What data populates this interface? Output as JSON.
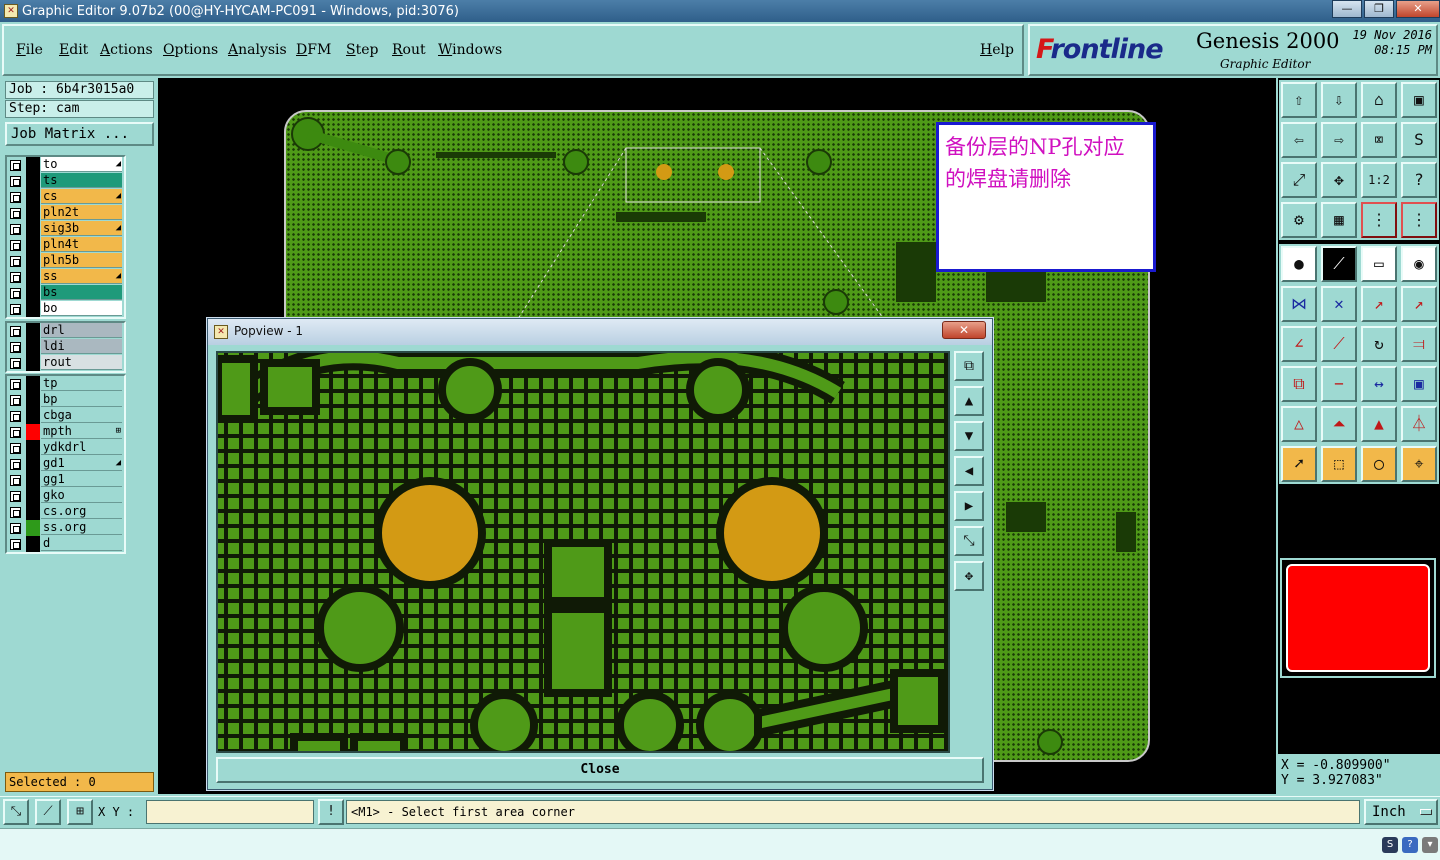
{
  "window": {
    "title": "Graphic Editor 9.07b2 (00@HY-HYCAM-PC091 - Windows, pid:3076)",
    "icon": "app-icon"
  },
  "menu": {
    "items": [
      "File",
      "Edit",
      "Actions",
      "Options",
      "Analysis",
      "DFM",
      "Step",
      "Rout",
      "Windows"
    ],
    "help": "Help"
  },
  "logo": {
    "brand_f": "F",
    "brand_rest": "rontline",
    "product": "Genesis 2000",
    "subtitle": "Graphic Editor",
    "date": "19 Nov 2016",
    "time": "08:15 PM"
  },
  "job": {
    "job_label": "Job : 6b4r3015a0",
    "step_label": "Step: cam",
    "matrix_button": "Job Matrix ..."
  },
  "layers": {
    "group1": [
      {
        "name": "to",
        "color": "#ffffff",
        "mark": "◢"
      },
      {
        "name": "ts",
        "color": "#1f9a7a",
        "mark": ""
      },
      {
        "name": "cs",
        "color": "#f2b84a",
        "mark": "◢"
      },
      {
        "name": "pln2t",
        "color": "#f2b84a",
        "mark": ""
      },
      {
        "name": "sig3b",
        "color": "#f2b84a",
        "mark": "◢"
      },
      {
        "name": "pln4t",
        "color": "#f2b84a",
        "mark": ""
      },
      {
        "name": "pln5b",
        "color": "#f2b84a",
        "mark": ""
      },
      {
        "name": "ss",
        "color": "#f2b84a",
        "mark": "◢"
      },
      {
        "name": "bs",
        "color": "#1f9a7a",
        "mark": ""
      },
      {
        "name": "bo",
        "color": "#ffffff",
        "mark": ""
      }
    ],
    "group2": [
      {
        "name": "drl",
        "color": "#aab8c0",
        "mark": ""
      },
      {
        "name": "ldi",
        "color": "#aab8c0",
        "mark": ""
      },
      {
        "name": "rout",
        "color": "#d8e0e2",
        "mark": ""
      }
    ],
    "group3": [
      {
        "name": "tp",
        "color": "#9ed9d2",
        "mark": ""
      },
      {
        "name": "bp",
        "color": "#9ed9d2",
        "mark": ""
      },
      {
        "name": "cbga",
        "color": "#9ed9d2",
        "mark": ""
      },
      {
        "name": "mpth",
        "color": "#9ed9d2",
        "mark": "⊞"
      },
      {
        "name": "ydkdrl",
        "color": "#9ed9d2",
        "mark": ""
      },
      {
        "name": "gd1",
        "color": "#9ed9d2",
        "mark": "◢"
      },
      {
        "name": "gg1",
        "color": "#9ed9d2",
        "mark": ""
      },
      {
        "name": "gko",
        "color": "#9ed9d2",
        "mark": ""
      },
      {
        "name": "cs.org",
        "color": "#9ed9d2",
        "mark": ""
      },
      {
        "name": "ss.org",
        "color": "#9ed9d2",
        "mark": ""
      },
      {
        "name": "d",
        "color": "#9ed9d2",
        "mark": ""
      }
    ],
    "swatch_colors": {
      "mpth": "#ff0000",
      "ss.org": "#2e9a1a",
      "default": "#000000"
    },
    "selected": "Selected : 0"
  },
  "annotation": {
    "line1": "备份层的NP孔对应",
    "line2": "的焊盘请删除"
  },
  "popview": {
    "title": "Popview - 1",
    "close_label": "Close",
    "close_x": "✕"
  },
  "colors": {
    "copper": "#4f9a18",
    "pad_gold": "#d39a14",
    "mask_dark": "#101a06",
    "active_red": "#ff0000",
    "ui_teal": "#9ed9d2"
  },
  "coords": {
    "x": "X = -0.809900\"",
    "y": "Y = 3.927083\""
  },
  "bottom": {
    "xy_label": "X Y :",
    "xy_value": "",
    "prompt": "<M1> - Select first area corner",
    "unit": "Inch"
  }
}
